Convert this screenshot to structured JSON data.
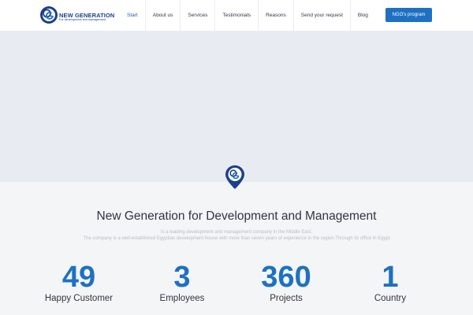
{
  "brand": {
    "logo_text": "NG",
    "title": "NEW GENERATION",
    "subtitle": "For development and management",
    "colors": {
      "primary": "#1c3f8f",
      "accent": "#1e71c2"
    }
  },
  "nav": {
    "items": [
      {
        "label": "Start"
      },
      {
        "label": "About us"
      },
      {
        "label": "Services"
      },
      {
        "label": "Testimonials"
      },
      {
        "label": "Reasons"
      },
      {
        "label": "Send your request"
      },
      {
        "label": "Blog"
      }
    ],
    "cta_label": "NGO's program"
  },
  "hero": {
    "marker_icon": "location-pin-icon"
  },
  "intro": {
    "title": "New Generation for Development and Management",
    "line1": "Is a leading development and management company in the Middle East.",
    "line2": "The company is a well-established Egyptian development house with more than seven years of experience in the region.Through its office in Egypt"
  },
  "stats": [
    {
      "value": "49",
      "label": "Happy Customer"
    },
    {
      "value": "3",
      "label": "Employees"
    },
    {
      "value": "360",
      "label": "Projects"
    },
    {
      "value": "1",
      "label": "Country"
    }
  ]
}
